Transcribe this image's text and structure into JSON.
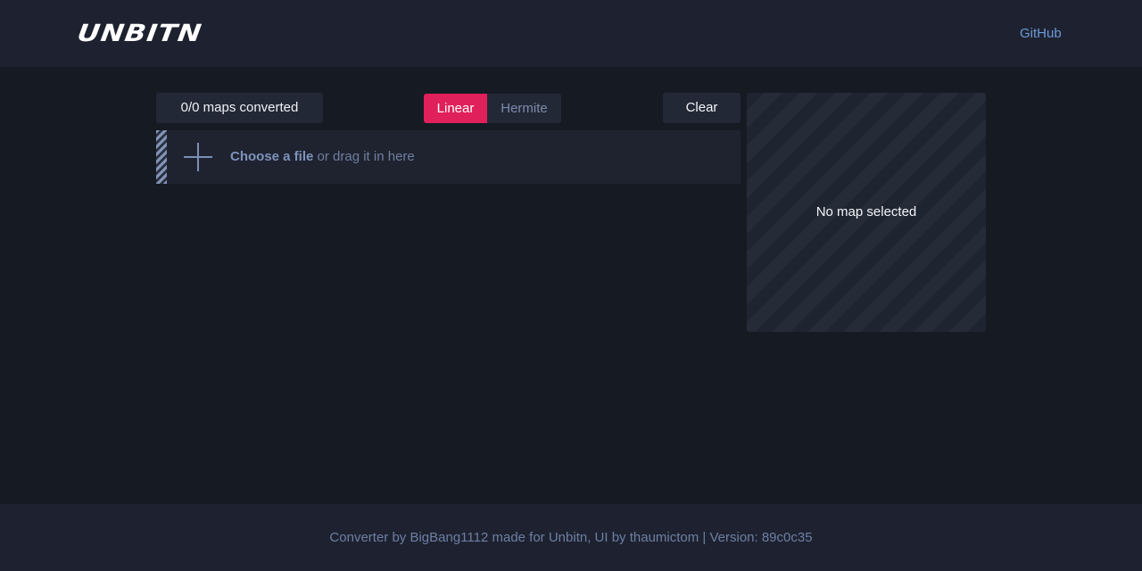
{
  "header": {
    "logo": "UNBITN",
    "github_link": "GitHub"
  },
  "toolbar": {
    "counter": "0/0 maps converted",
    "modes": [
      {
        "label": "Linear",
        "active": true
      },
      {
        "label": "Hermite",
        "active": false
      }
    ],
    "clear_label": "Clear"
  },
  "dropzone": {
    "choose_label": "Choose a file",
    "drag_label": " or drag it in here",
    "icon": "plus-icon"
  },
  "preview": {
    "empty_text": "No map selected"
  },
  "footer": {
    "text": "Converter by BigBang1112 made for Unbitn, UI by thaumictom | Version: 89c0c35"
  },
  "colors": {
    "accent": "#e0205a",
    "link": "#6e9ad8",
    "background": "#161a23",
    "panel": "#232836"
  }
}
